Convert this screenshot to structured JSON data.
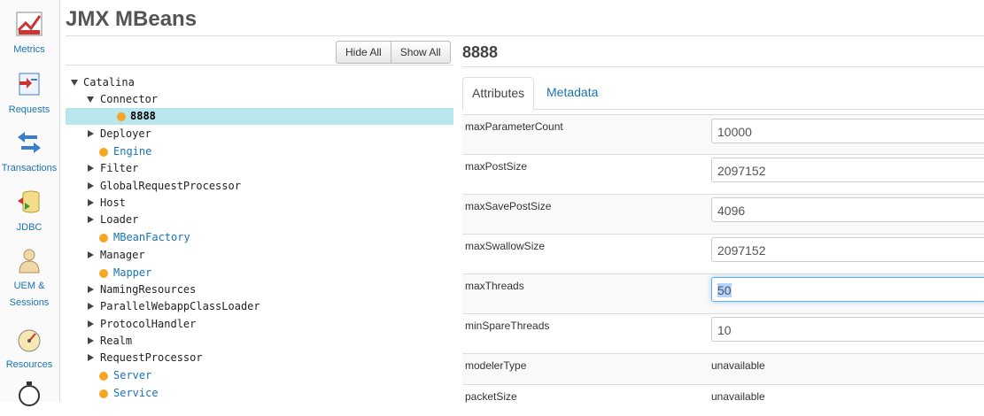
{
  "sidebar": {
    "items": [
      {
        "label": "Metrics"
      },
      {
        "label": "Requests"
      },
      {
        "label": "Transactions"
      },
      {
        "label": "JDBC"
      },
      {
        "label1": "UEM &",
        "label2": "Sessions"
      },
      {
        "label": "Resources"
      }
    ]
  },
  "header": {
    "title": "JMX MBeans"
  },
  "tree_toolbar": {
    "hide_all": "Hide All",
    "show_all": "Show All"
  },
  "tree": {
    "nodes": [
      {
        "text": "Catalina",
        "kind": "expanded"
      },
      {
        "text": "Connector",
        "kind": "expanded"
      },
      {
        "text": "8888",
        "kind": "selected-leaf"
      },
      {
        "text": "Deployer",
        "kind": "collapsed"
      },
      {
        "text": "Engine",
        "kind": "leaf"
      },
      {
        "text": "Filter",
        "kind": "collapsed"
      },
      {
        "text": "GlobalRequestProcessor",
        "kind": "collapsed"
      },
      {
        "text": "Host",
        "kind": "collapsed"
      },
      {
        "text": "Loader",
        "kind": "collapsed"
      },
      {
        "text": "MBeanFactory",
        "kind": "leaf"
      },
      {
        "text": "Manager",
        "kind": "collapsed"
      },
      {
        "text": "Mapper",
        "kind": "leaf"
      },
      {
        "text": "NamingResources",
        "kind": "collapsed"
      },
      {
        "text": "ParallelWebappClassLoader",
        "kind": "collapsed"
      },
      {
        "text": "ProtocolHandler",
        "kind": "collapsed"
      },
      {
        "text": "Realm",
        "kind": "collapsed"
      },
      {
        "text": "RequestProcessor",
        "kind": "collapsed"
      },
      {
        "text": "Server",
        "kind": "leaf"
      },
      {
        "text": "Service",
        "kind": "leaf"
      }
    ]
  },
  "detail": {
    "title": "8888",
    "tabs": [
      {
        "label": "Attributes",
        "active": true
      },
      {
        "label": "Metadata",
        "active": false
      }
    ],
    "attributes": [
      {
        "name": "maxParameterCount",
        "value": "10000",
        "editable": true
      },
      {
        "name": "maxPostSize",
        "value": "2097152",
        "editable": true
      },
      {
        "name": "maxSavePostSize",
        "value": "4096",
        "editable": true
      },
      {
        "name": "maxSwallowSize",
        "value": "2097152",
        "editable": true
      },
      {
        "name": "maxThreads",
        "value": "50",
        "editable": true,
        "focused": true
      },
      {
        "name": "minSpareThreads",
        "value": "10",
        "editable": true
      },
      {
        "name": "modelerType",
        "value": "unavailable",
        "editable": false
      },
      {
        "name": "packetSize",
        "value": "unavailable",
        "editable": false
      }
    ]
  },
  "colors": {
    "accent": "#1a73b5",
    "selected_row": "#b9e5ed",
    "leaf_dot": "#f5a623"
  }
}
